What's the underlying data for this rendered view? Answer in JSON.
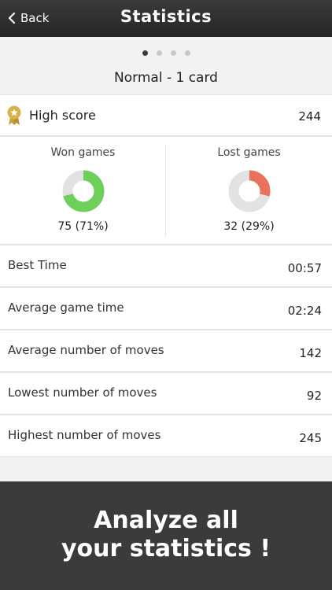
{
  "nav": {
    "back_label": "Back",
    "title": "Statistics"
  },
  "pager": {
    "count": 4,
    "active": 0
  },
  "section_title": "Normal - 1 card",
  "high_score": {
    "label": "High score",
    "value": "244"
  },
  "won": {
    "title": "Won games",
    "value": "75 (71%)",
    "fraction": 0.71,
    "color": "#6fcf5b"
  },
  "lost": {
    "title": "Lost games",
    "value": "32 (29%)",
    "fraction": 0.29,
    "color": "#e8725a"
  },
  "ring_track_color": "#e2e2e2",
  "rows": [
    {
      "label": "Best Time",
      "value": "00:57"
    },
    {
      "label": "Average game time",
      "value": "02:24"
    },
    {
      "label": "Average number of moves",
      "value": "142"
    },
    {
      "label": "Lowest number of moves",
      "value": "92"
    },
    {
      "label": "Highest number of moves",
      "value": "245"
    }
  ],
  "promo": {
    "line1": "Analyze all",
    "line2": "your statistics !"
  }
}
